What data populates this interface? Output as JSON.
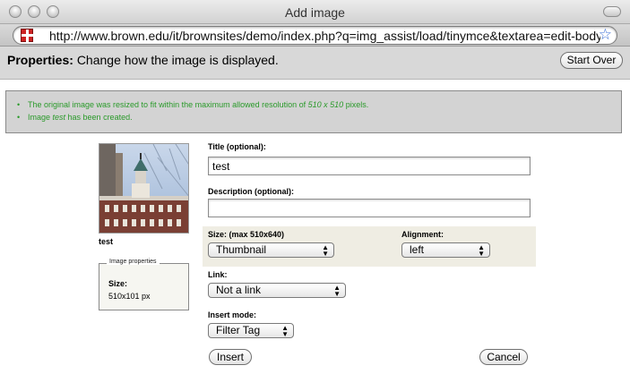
{
  "window": {
    "title": "Add image"
  },
  "browser": {
    "url": "http://www.brown.edu/it/brownsites/demo/index.php?q=img_assist/load/tinymce&textarea=edit-body"
  },
  "properties": {
    "heading": "Properties:",
    "subtitle": "Change how the image is displayed.",
    "start_over": "Start Over"
  },
  "messages": {
    "msg1_before": "The original image was resized to fit within the maximum allowed resolution of ",
    "msg1_res": "510 x 510",
    "msg1_after": " pixels.",
    "msg2_before": "Image ",
    "msg2_name": "test",
    "msg2_after": " has been created."
  },
  "image": {
    "name": "test",
    "properties_legend": "Image properties",
    "size_label": "Size:",
    "size_value": "510x101 px"
  },
  "form": {
    "title_label": "Title (optional):",
    "title_value": "test",
    "description_label": "Description (optional):",
    "description_value": "",
    "size_label": "Size: (max 510x640)",
    "size_value": "Thumbnail",
    "alignment_label": "Alignment:",
    "alignment_value": "left",
    "link_label": "Link:",
    "link_value": "Not a link",
    "insert_mode_label": "Insert mode:",
    "insert_mode_value": "Filter Tag",
    "insert_button": "Insert",
    "cancel_button": "Cancel"
  },
  "icons": {
    "close": "close-icon",
    "minimize": "minimize-icon",
    "zoom": "zoom-icon",
    "favicon": "brown-favicon-icon",
    "bookmark": "bookmark-star-icon",
    "select_arrows": "up-down-arrows-icon"
  },
  "colors": {
    "success_text": "#2a9a2a",
    "panel_bg": "#efede3",
    "bar_bg": "#d8d8d8"
  }
}
